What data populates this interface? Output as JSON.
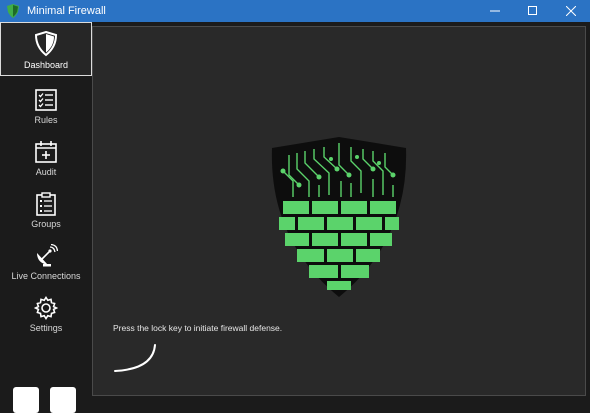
{
  "window": {
    "title": "Minimal Firewall",
    "minimize_icon": "minimize-icon",
    "maximize_icon": "maximize-icon",
    "close_icon": "close-icon"
  },
  "sidebar": {
    "items": [
      {
        "label": "Dashboard",
        "icon": "shield-icon",
        "active": true
      },
      {
        "label": "Rules",
        "icon": "rules-list-icon"
      },
      {
        "label": "Audit",
        "icon": "calendar-plus-icon"
      },
      {
        "label": "Groups",
        "icon": "clipboard-icon"
      },
      {
        "label": "Live Connections",
        "icon": "satellite-dish-icon"
      },
      {
        "label": "Settings",
        "icon": "gear-icon"
      }
    ]
  },
  "main": {
    "status_text": "Press the lock key to initiate firewall defense."
  },
  "colors": {
    "titlebar": "#2b73c4",
    "accent_green": "#5bd36b",
    "panel": "#292929",
    "sidebar": "#1b1b1b"
  }
}
